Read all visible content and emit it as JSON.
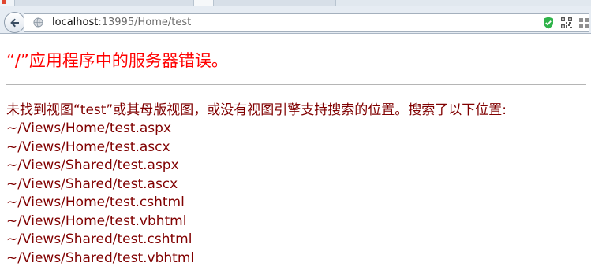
{
  "browser": {
    "address": {
      "host": "localhost",
      "rest": ":13995/Home/test"
    },
    "icons": {
      "back": "back-arrow-icon",
      "site": "globe-icon",
      "security": "shield-check-icon",
      "qr": "qr-code-icon",
      "extension": "tile-icon"
    }
  },
  "page": {
    "title": "“/”应用程序中的服务器错误。",
    "message": "未找到视图“test”或其母版视图，或没有视图引擎支持搜索的位置。搜索了以下位置:",
    "paths": [
      "~/Views/Home/test.aspx",
      "~/Views/Home/test.ascx",
      "~/Views/Shared/test.aspx",
      "~/Views/Shared/test.ascx",
      "~/Views/Home/test.cshtml",
      "~/Views/Home/test.vbhtml",
      "~/Views/Shared/test.cshtml",
      "~/Views/Shared/test.vbhtml"
    ]
  },
  "colors": {
    "title": "#ff0000",
    "body_text": "#800000",
    "divider": "#b5b5b5",
    "security_icon": "#2fb34a"
  }
}
